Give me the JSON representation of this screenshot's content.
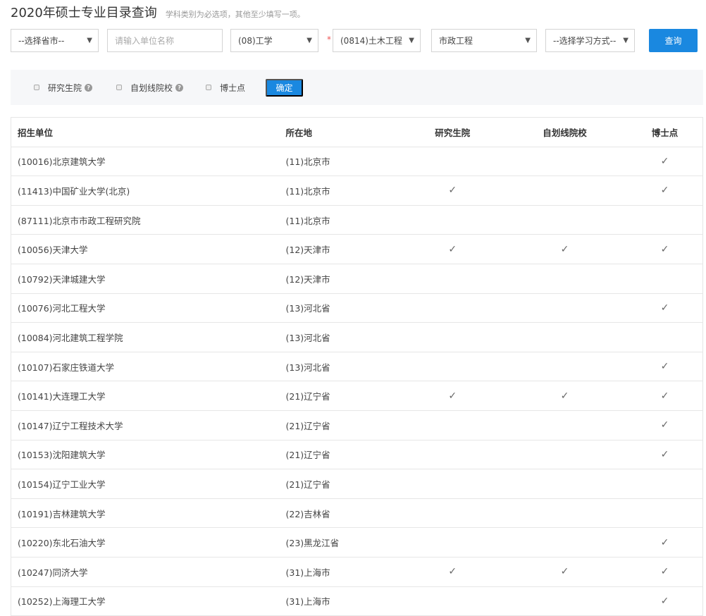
{
  "header": {
    "title": "2020年硕士专业目录查询",
    "hint": "学科类别为必选项，其他至少填写一项。"
  },
  "filters": {
    "province": "--选择省市--",
    "unit_placeholder": "请输入单位名称",
    "category": "(08)工学",
    "required_mark": "*",
    "discipline": "(0814)土木工程",
    "major": "市政工程",
    "study_mode": "--选择学习方式--",
    "query_label": "查询",
    "arrow": "▼"
  },
  "options": {
    "items": [
      "研究生院",
      "自划线院校",
      "博士点"
    ],
    "help": "?",
    "confirm_label": "确定"
  },
  "table": {
    "headers": [
      "招生单位",
      "所在地",
      "研究生院",
      "自划线院校",
      "博士点"
    ],
    "check": "✓",
    "rows": [
      {
        "unit": "(10016)北京建筑大学",
        "loc": "(11)北京市",
        "grad": false,
        "self": false,
        "phd": true
      },
      {
        "unit": "(11413)中国矿业大学(北京)",
        "loc": "(11)北京市",
        "grad": true,
        "self": false,
        "phd": true
      },
      {
        "unit": "(87111)北京市市政工程研究院",
        "loc": "(11)北京市",
        "grad": false,
        "self": false,
        "phd": false
      },
      {
        "unit": "(10056)天津大学",
        "loc": "(12)天津市",
        "grad": true,
        "self": true,
        "phd": true
      },
      {
        "unit": "(10792)天津城建大学",
        "loc": "(12)天津市",
        "grad": false,
        "self": false,
        "phd": false
      },
      {
        "unit": "(10076)河北工程大学",
        "loc": "(13)河北省",
        "grad": false,
        "self": false,
        "phd": true
      },
      {
        "unit": "(10084)河北建筑工程学院",
        "loc": "(13)河北省",
        "grad": false,
        "self": false,
        "phd": false
      },
      {
        "unit": "(10107)石家庄铁道大学",
        "loc": "(13)河北省",
        "grad": false,
        "self": false,
        "phd": true
      },
      {
        "unit": "(10141)大连理工大学",
        "loc": "(21)辽宁省",
        "grad": true,
        "self": true,
        "phd": true
      },
      {
        "unit": "(10147)辽宁工程技术大学",
        "loc": "(21)辽宁省",
        "grad": false,
        "self": false,
        "phd": true
      },
      {
        "unit": "(10153)沈阳建筑大学",
        "loc": "(21)辽宁省",
        "grad": false,
        "self": false,
        "phd": true
      },
      {
        "unit": "(10154)辽宁工业大学",
        "loc": "(21)辽宁省",
        "grad": false,
        "self": false,
        "phd": false
      },
      {
        "unit": "(10191)吉林建筑大学",
        "loc": "(22)吉林省",
        "grad": false,
        "self": false,
        "phd": false
      },
      {
        "unit": "(10220)东北石油大学",
        "loc": "(23)黑龙江省",
        "grad": false,
        "self": false,
        "phd": true
      },
      {
        "unit": "(10247)同济大学",
        "loc": "(31)上海市",
        "grad": true,
        "self": true,
        "phd": true
      },
      {
        "unit": "(10252)上海理工大学",
        "loc": "(31)上海市",
        "grad": false,
        "self": false,
        "phd": true
      }
    ]
  }
}
